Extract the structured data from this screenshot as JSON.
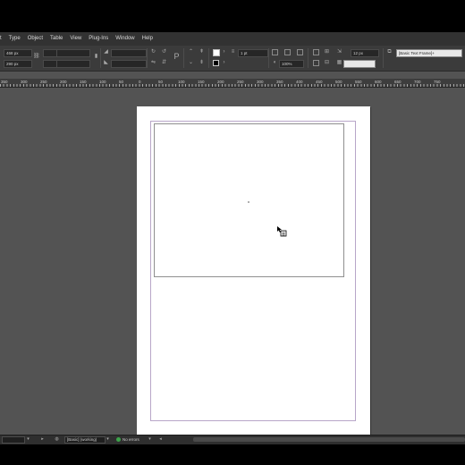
{
  "menu": [
    "t",
    "Type",
    "Object",
    "Table",
    "View",
    "Plug-Ins",
    "Window",
    "Help"
  ],
  "control": {
    "x_value": "468 px",
    "y_value": "290 px",
    "stroke_weight": "1 pt",
    "zoom_percent": "100%",
    "gutter_value": "12 px",
    "frame_style": "[Basic Text Frame]+"
  },
  "ruler_labels": [
    "350",
    "300",
    "250",
    "200",
    "150",
    "100",
    "50",
    "0",
    "50",
    "100",
    "150",
    "200",
    "250",
    "300",
    "350",
    "400",
    "450",
    "500",
    "550",
    "600",
    "650",
    "700",
    "750"
  ],
  "status": {
    "style": "[Basic] (working)",
    "errors": "No errors"
  },
  "colors": {
    "app_bg": "#535353",
    "menubar": "#323232",
    "status_ok": "#3ca44a"
  }
}
